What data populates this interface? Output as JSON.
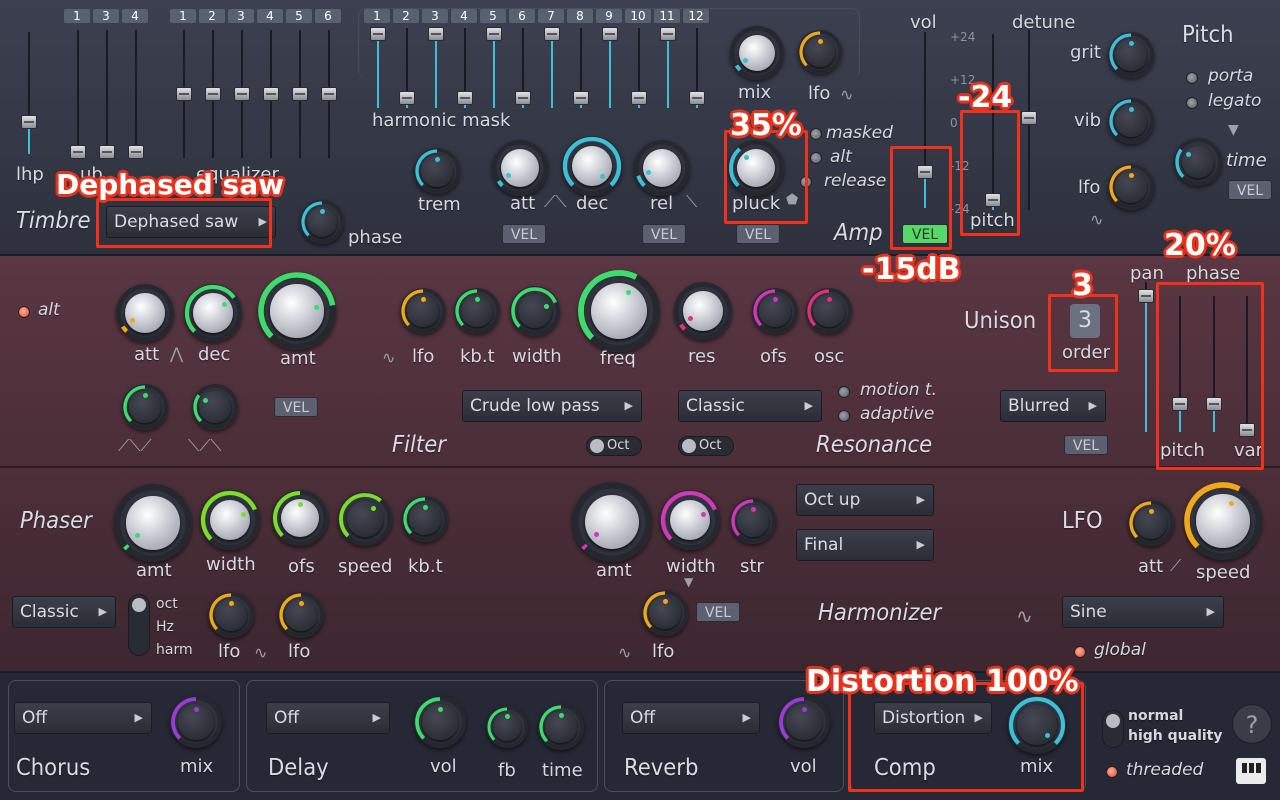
{
  "timbre": {
    "title": "Timbre",
    "lhp": "lhp",
    "sub": "ub",
    "equalizer": "equalizer",
    "waveform": "Dephased saw",
    "phase": "phase",
    "sub_nums": [
      "1",
      "3",
      "4"
    ],
    "eq_nums": [
      "1",
      "2",
      "3",
      "4",
      "5",
      "6"
    ]
  },
  "harmonic": {
    "title": "harmonic mask",
    "nums": [
      "1",
      "2",
      "3",
      "4",
      "5",
      "6",
      "7",
      "8",
      "9",
      "10",
      "11",
      "12"
    ],
    "mix": "mix",
    "lfo": "lfo",
    "trem": "trem",
    "att": "att",
    "dec": "dec",
    "rel": "rel",
    "pluck": "pluck",
    "masked": "masked",
    "alt": "alt",
    "release": "release",
    "vel": "VEL"
  },
  "amp": {
    "title": "Amp",
    "vol": "vol",
    "detune": "detune",
    "pitch": "pitch",
    "vel": "VEL",
    "scale": [
      "+24",
      "+12",
      "0",
      "-12",
      "-24"
    ],
    "grit": "grit",
    "vib": "vib",
    "lfo": "lfo"
  },
  "pitch": {
    "title": "Pitch",
    "porta": "porta",
    "legato": "legato",
    "time": "time",
    "vel": "VEL"
  },
  "filter": {
    "title": "Filter",
    "alt": "alt",
    "att": "att",
    "dec": "dec",
    "amt": "amt",
    "lfo": "lfo",
    "kbt": "kb.t",
    "width": "width",
    "freq": "freq",
    "res": "res",
    "ofs": "ofs",
    "osc": "osc",
    "type": "Crude low pass",
    "oct": "Oct",
    "vel": "VEL"
  },
  "resonance": {
    "title": "Resonance",
    "type": "Classic",
    "oct": "Oct",
    "motion": "motion t.",
    "adaptive": "adaptive"
  },
  "unison": {
    "title": "Unison",
    "order_value": "3",
    "order": "order",
    "pan": "pan",
    "phase": "phase",
    "pitch": "pitch",
    "var": "var",
    "mode": "Blurred",
    "vel": "VEL"
  },
  "phaser": {
    "title": "Phaser",
    "amt": "amt",
    "width": "width",
    "ofs": "ofs",
    "speed": "speed",
    "kbt": "kb.t",
    "type": "Classic",
    "oct": "oct",
    "hz": "Hz",
    "harm": "harm",
    "lfo1": "lfo",
    "lfo2": "lfo"
  },
  "harmonizer": {
    "title": "Harmonizer",
    "amt": "amt",
    "width": "width",
    "str": "str",
    "lfo": "lfo",
    "vel": "VEL",
    "mode1": "Oct up",
    "mode2": "Final"
  },
  "lfo": {
    "title": "LFO",
    "att": "att",
    "speed": "speed",
    "shape": "Sine",
    "global": "global"
  },
  "chorus": {
    "title": "Chorus",
    "type": "Off",
    "mix": "mix"
  },
  "delay": {
    "title": "Delay",
    "type": "Off",
    "vol": "vol",
    "fb": "fb",
    "time": "time"
  },
  "reverb": {
    "title": "Reverb",
    "type": "Off",
    "vol": "vol"
  },
  "comp": {
    "title": "Comp",
    "type": "Distortion",
    "mix": "mix"
  },
  "quality": {
    "normal": "normal",
    "high": "high quality",
    "threaded": "threaded",
    "help": "?"
  },
  "annotations": {
    "waveform": "Dephased saw",
    "pluck": "35%",
    "pitch": "-24",
    "vol": "-15dB",
    "order": "3",
    "phase": "20%",
    "comp": "Distortion 100%"
  },
  "colors": {
    "cyan": "#3cc0d8",
    "green": "#3ddc6c",
    "lime": "#7bdc2c",
    "orange": "#f0a818",
    "magenta": "#d038b8",
    "pink": "#e0307a",
    "annotation": "#f0311e"
  }
}
